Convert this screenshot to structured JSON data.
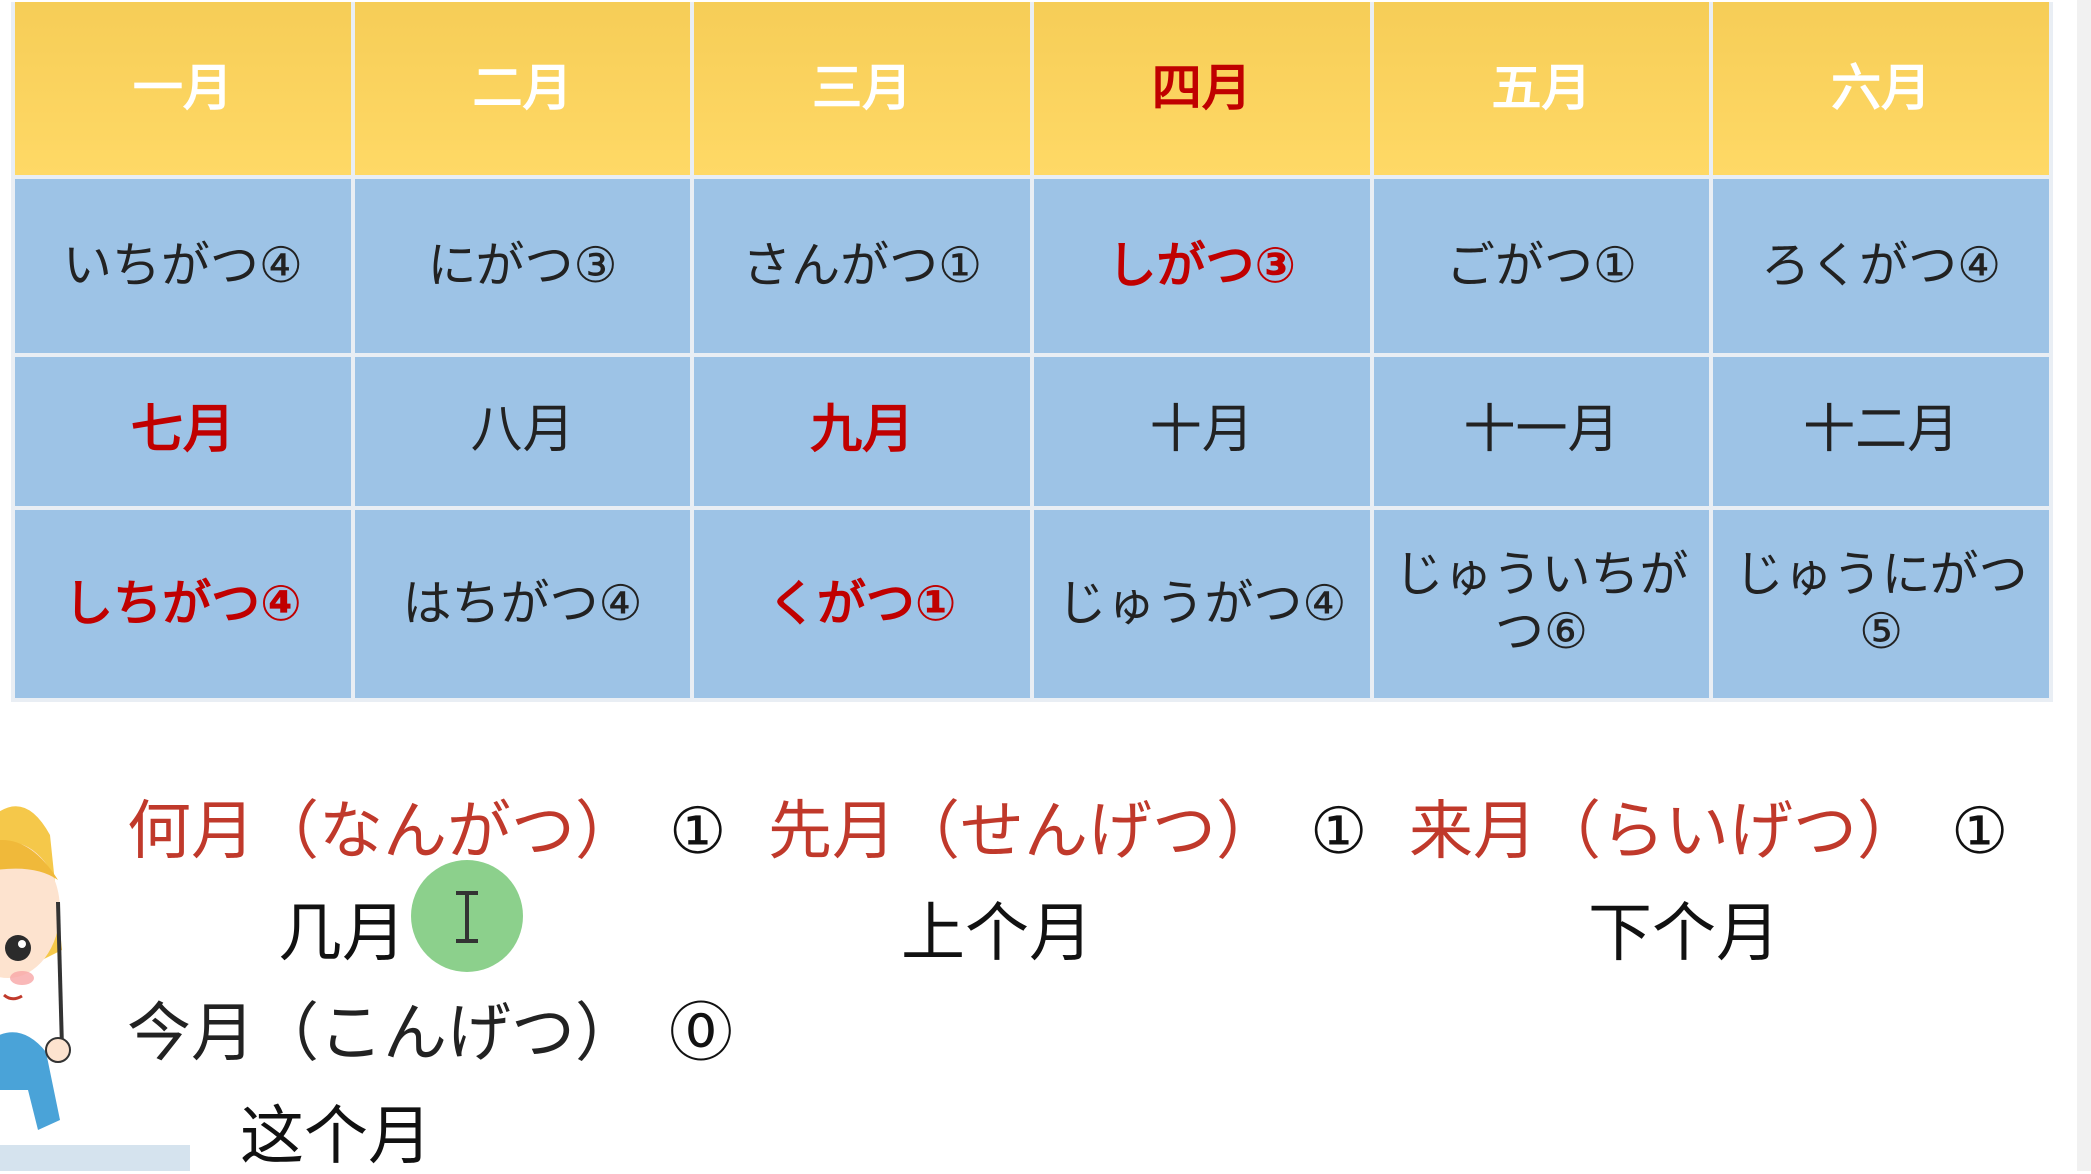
{
  "table": {
    "header_months": [
      {
        "text": "一月",
        "highlight": false
      },
      {
        "text": "二月",
        "highlight": false
      },
      {
        "text": "三月",
        "highlight": false
      },
      {
        "text": "四月",
        "highlight": true
      },
      {
        "text": "五月",
        "highlight": false
      },
      {
        "text": "六月",
        "highlight": false
      }
    ],
    "header_readings": [
      {
        "text": "いちがつ④",
        "highlight": false
      },
      {
        "text": "にがつ③",
        "highlight": false
      },
      {
        "text": "さんがつ①",
        "highlight": false
      },
      {
        "text": "しがつ③",
        "highlight": true
      },
      {
        "text": "ごがつ①",
        "highlight": false
      },
      {
        "text": "ろくがつ④",
        "highlight": false
      }
    ],
    "months": [
      {
        "text": "七月",
        "highlight": true
      },
      {
        "text": "八月",
        "highlight": false
      },
      {
        "text": "九月",
        "highlight": true
      },
      {
        "text": "十月",
        "highlight": false
      },
      {
        "text": "十一月",
        "highlight": false
      },
      {
        "text": "十二月",
        "highlight": false
      }
    ],
    "readings": [
      {
        "text": "しちがつ④",
        "highlight": true
      },
      {
        "text": "はちがつ④",
        "highlight": false
      },
      {
        "text": "くがつ①",
        "highlight": true
      },
      {
        "text": "じゅうがつ④",
        "highlight": false
      },
      {
        "text": "じゅういちがつ⑥",
        "highlight": false
      },
      {
        "text": "じゅうにがつ⑤",
        "highlight": false
      }
    ]
  },
  "vocab": {
    "nangatsu": {
      "term": "何月（なんがつ）",
      "accent": "①",
      "meaning": "几月"
    },
    "sengetsu": {
      "term": "先月（せんげつ）",
      "accent": "①",
      "meaning": "上个月"
    },
    "raigetsu": {
      "term": "来月（らいげつ）",
      "accent": "①",
      "meaning": "下个月"
    },
    "kongetsu": {
      "term": "今月（こんげつ）",
      "accent": "⓪",
      "meaning": "这个月"
    }
  },
  "colors": {
    "header_bg": "#ffd966",
    "cell_bg": "#9dc3e6",
    "highlight_text": "#c00000",
    "term_text": "#c0392b",
    "cursor_highlight": "#60be60"
  },
  "icons": [
    "teacher-figure",
    "text-cursor-icon"
  ]
}
